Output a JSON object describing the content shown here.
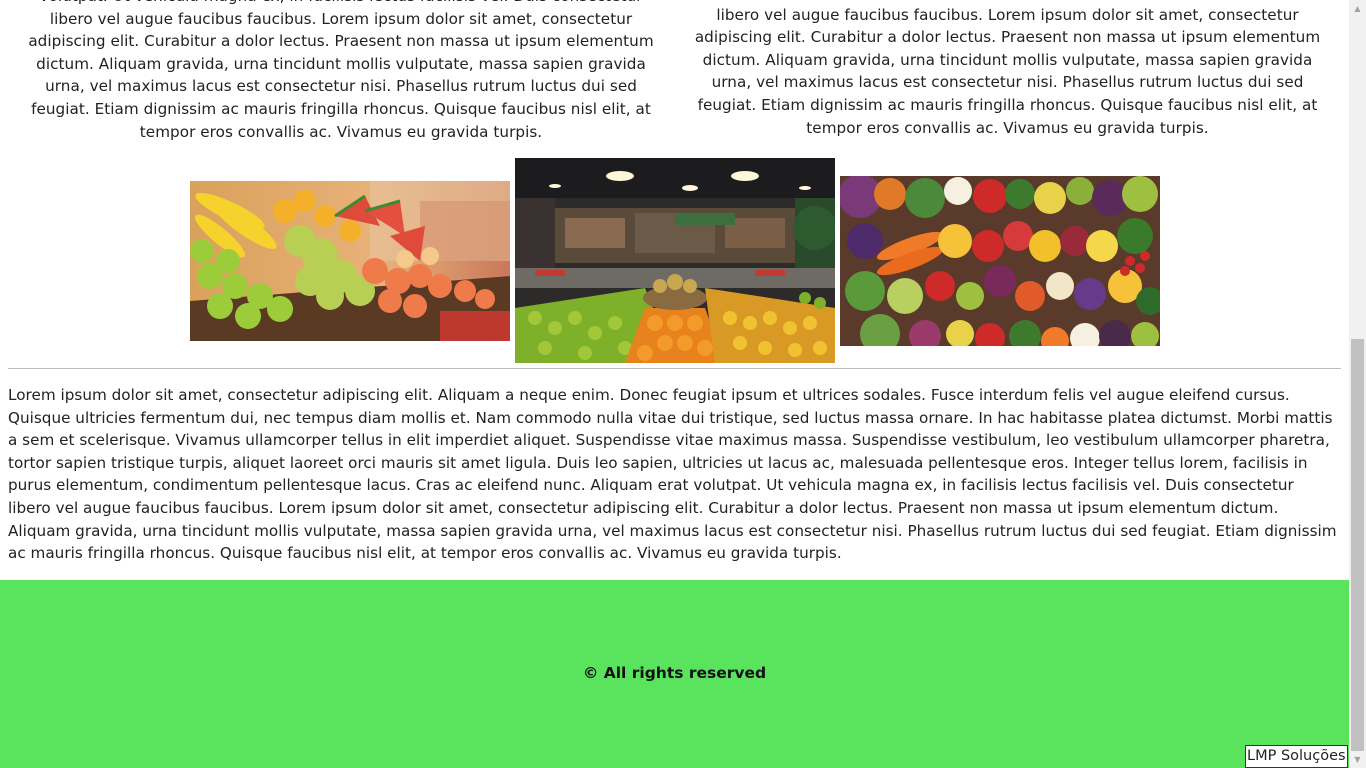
{
  "columns": {
    "left_text": "volutpat. Ut vehicula magna ex, in facilisis lectus facilisis vel. Duis consectetur libero vel augue faucibus faucibus. Lorem ipsum dolor sit amet, consectetur adipiscing elit. Curabitur a dolor lectus. Praesent non massa ut ipsum elementum dictum. Aliquam gravida, urna tincidunt mollis vulputate, massa sapien gravida urna, vel maximus lacus est consectetur nisi. Phasellus rutrum luctus dui sed feugiat. Etiam dignissim ac mauris fringilla rhoncus. Quisque faucibus nisl elit, at tempor eros convallis ac. Vivamus eu gravida turpis.",
    "right_text": "volutpat. Ut vehicula magna ex, in facilisis lectus facilisis vel. Duis consectetur libero vel augue faucibus faucibus. Lorem ipsum dolor sit amet, consectetur adipiscing elit. Curabitur a dolor lectus. Praesent non massa ut ipsum elementum dictum. Aliquam gravida, urna tincidunt mollis vulputate, massa sapien gravida urna, vel maximus lacus est consectetur nisi. Phasellus rutrum luctus dui sed feugiat. Etiam dignissim ac mauris fringilla rhoncus. Quisque faucibus nisl elit, at tempor eros convallis ac. Vivamus eu gravida turpis."
  },
  "gallery": {
    "images": [
      {
        "subject": "fruit-stand-bananas-apples-grapes-watermelon"
      },
      {
        "subject": "supermarket-produce-aisle-oranges-limes"
      },
      {
        "subject": "assorted-fresh-vegetables-flat-lay"
      }
    ]
  },
  "main": {
    "paragraph": "Lorem ipsum dolor sit amet, consectetur adipiscing elit. Aliquam a neque enim. Donec feugiat ipsum et ultrices sodales. Fusce interdum felis vel augue eleifend cursus. Quisque ultricies fermentum dui, nec tempus diam mollis et. Nam commodo nulla vitae dui tristique, sed luctus massa ornare. In hac habitasse platea dictumst. Morbi mattis a sem et scelerisque. Vivamus ullamcorper tellus in elit imperdiet aliquet. Suspendisse vitae maximus massa. Suspendisse vestibulum, leo vestibulum ullamcorper pharetra, tortor sapien tristique turpis, aliquet laoreet orci mauris sit amet ligula. Duis leo sapien, ultricies ut lacus ac, malesuada pellentesque eros. Integer tellus lorem, facilisis in purus elementum, condimentum pellentesque lacus. Cras ac eleifend nunc. Aliquam erat volutpat. Ut vehicula magna ex, in facilisis lectus facilisis vel. Duis consectetur libero vel augue faucibus faucibus. Lorem ipsum dolor sit amet, consectetur adipiscing elit. Curabitur a dolor lectus. Praesent non massa ut ipsum elementum dictum. Aliquam gravida, urna tincidunt mollis vulputate, massa sapien gravida urna, vel maximus lacus est consectetur nisi. Phasellus rutrum luctus dui sed feugiat. Etiam dignissim ac mauris fringilla rhoncus. Quisque faucibus nisl elit, at tempor eros convallis ac. Vivamus eu gravida turpis."
  },
  "footer": {
    "text": "© All rights reserved",
    "background_color": "#5ae35c"
  },
  "credit": {
    "label": "LMP Soluções"
  },
  "scrollbar": {
    "up_icon": "arrow-up-icon",
    "down_icon": "arrow-down-icon"
  }
}
